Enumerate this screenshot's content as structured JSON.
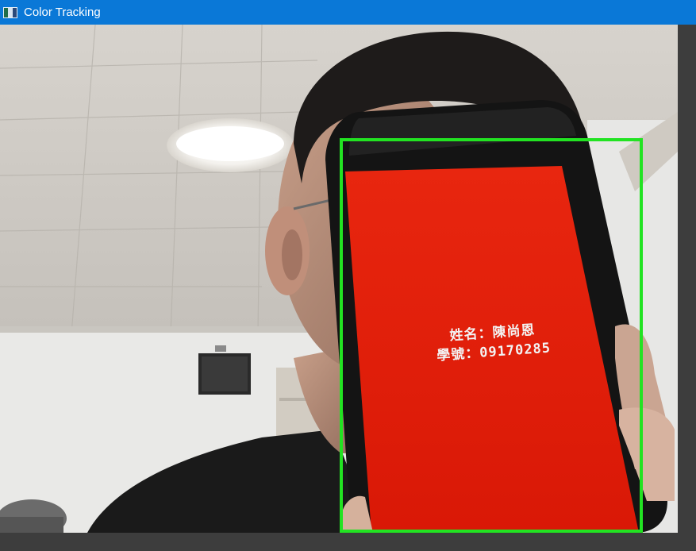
{
  "window": {
    "title": "Color Tracking",
    "app_icon": "opencv-window-icon"
  },
  "camera": {
    "phone_screen_lines": [
      "姓名：陳尚恩",
      "學號：09170285"
    ],
    "tracking_box_color": "#22e322",
    "tracked_color": "#e0170a"
  }
}
